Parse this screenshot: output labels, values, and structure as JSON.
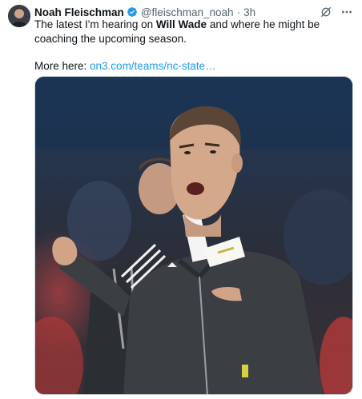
{
  "author": {
    "display_name": "Noah Fleischman",
    "handle": "@fleischman_noah",
    "separator": "·",
    "time": "3h",
    "verified": true,
    "verified_color": "#1d9bf0"
  },
  "tweet": {
    "text_before": "The latest I'm hearing on ",
    "bold_text": "Will Wade",
    "text_after": " and where he might be coaching the upcoming season.",
    "more_label": "More here: ",
    "link_text": "on3.com/teams/nc-state…",
    "link_color": "#1d9bf0"
  },
  "icons": {
    "grok": "grok-icon",
    "more": "more-icon"
  },
  "media": {
    "kind": "photo",
    "subject": "coach-yelling-on-sideline"
  }
}
